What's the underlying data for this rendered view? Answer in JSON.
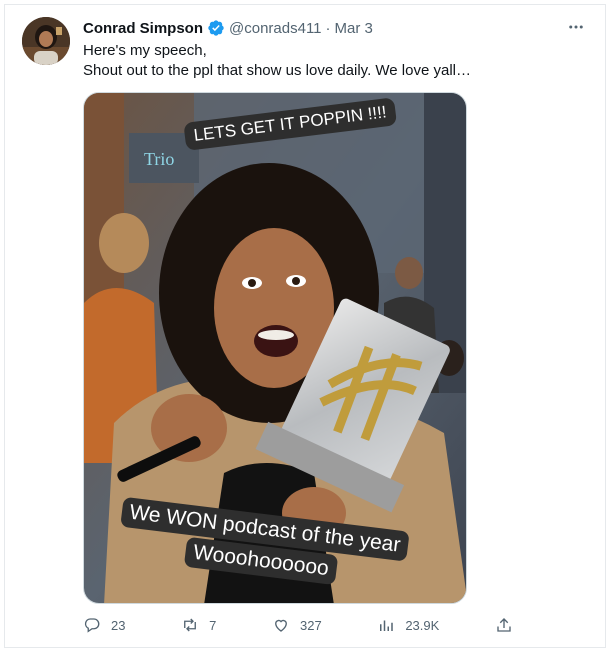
{
  "tweet": {
    "author_name": "Conrad Simpson",
    "handle": "@conrads411",
    "separator": "·",
    "date": "Mar 3",
    "text_line1": "Here's my speech,",
    "text_line2": "Shout out to the ppl that show us love daily. We love yall…",
    "image_caption_top": "LETS GET IT POPPIN !!!!",
    "image_caption_bottom_line1": "We WON podcast of the year",
    "image_caption_bottom_line2": "Wooohoooooo"
  },
  "actions": {
    "replies": "23",
    "reposts": "7",
    "likes": "327",
    "views": "23.9K"
  },
  "colors": {
    "verified": "#1d9bf0",
    "secondary_text": "#536471",
    "primary_text": "#0f1419"
  },
  "icons": {
    "verified": "verified-badge-icon",
    "more": "more-options-icon",
    "reply": "reply-icon",
    "repost": "repost-icon",
    "like": "like-icon",
    "views": "views-icon",
    "share": "share-icon"
  }
}
